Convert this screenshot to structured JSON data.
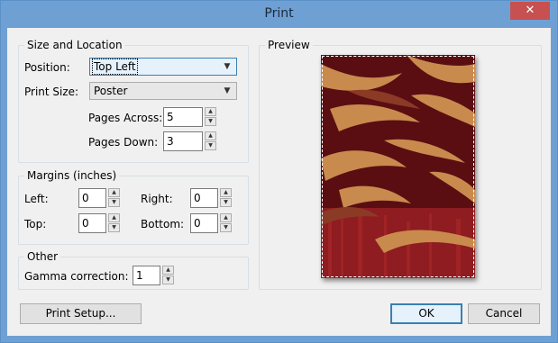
{
  "window": {
    "title": "Print",
    "close_glyph": "✕"
  },
  "size_location": {
    "legend": "Size and Location",
    "position_label": "Position:",
    "position_value": "Top Left",
    "print_size_label": "Print Size:",
    "print_size_value": "Poster",
    "pages_across_label": "Pages Across:",
    "pages_across_value": "5",
    "pages_down_label": "Pages Down:",
    "pages_down_value": "3"
  },
  "margins": {
    "legend": "Margins (inches)",
    "left_label": "Left:",
    "left_value": "0",
    "right_label": "Right:",
    "right_value": "0",
    "top_label": "Top:",
    "top_value": "0",
    "bottom_label": "Bottom:",
    "bottom_value": "0"
  },
  "other": {
    "legend": "Other",
    "gamma_label": "Gamma correction:",
    "gamma_value": "1"
  },
  "preview": {
    "legend": "Preview"
  },
  "buttons": {
    "print_setup": "Print Setup...",
    "ok": "OK",
    "cancel": "Cancel"
  },
  "icons": {
    "dropdown": "chevron-down-icon",
    "spin_up": "arrow-up-icon",
    "spin_down": "arrow-down-icon",
    "close": "close-icon"
  },
  "colors": {
    "titlebar": "#6fa0d4",
    "close": "#c75050",
    "dialog_bg": "#f0f0f0",
    "preview_dark": "#5a0e12",
    "preview_light": "#c98a4e"
  }
}
